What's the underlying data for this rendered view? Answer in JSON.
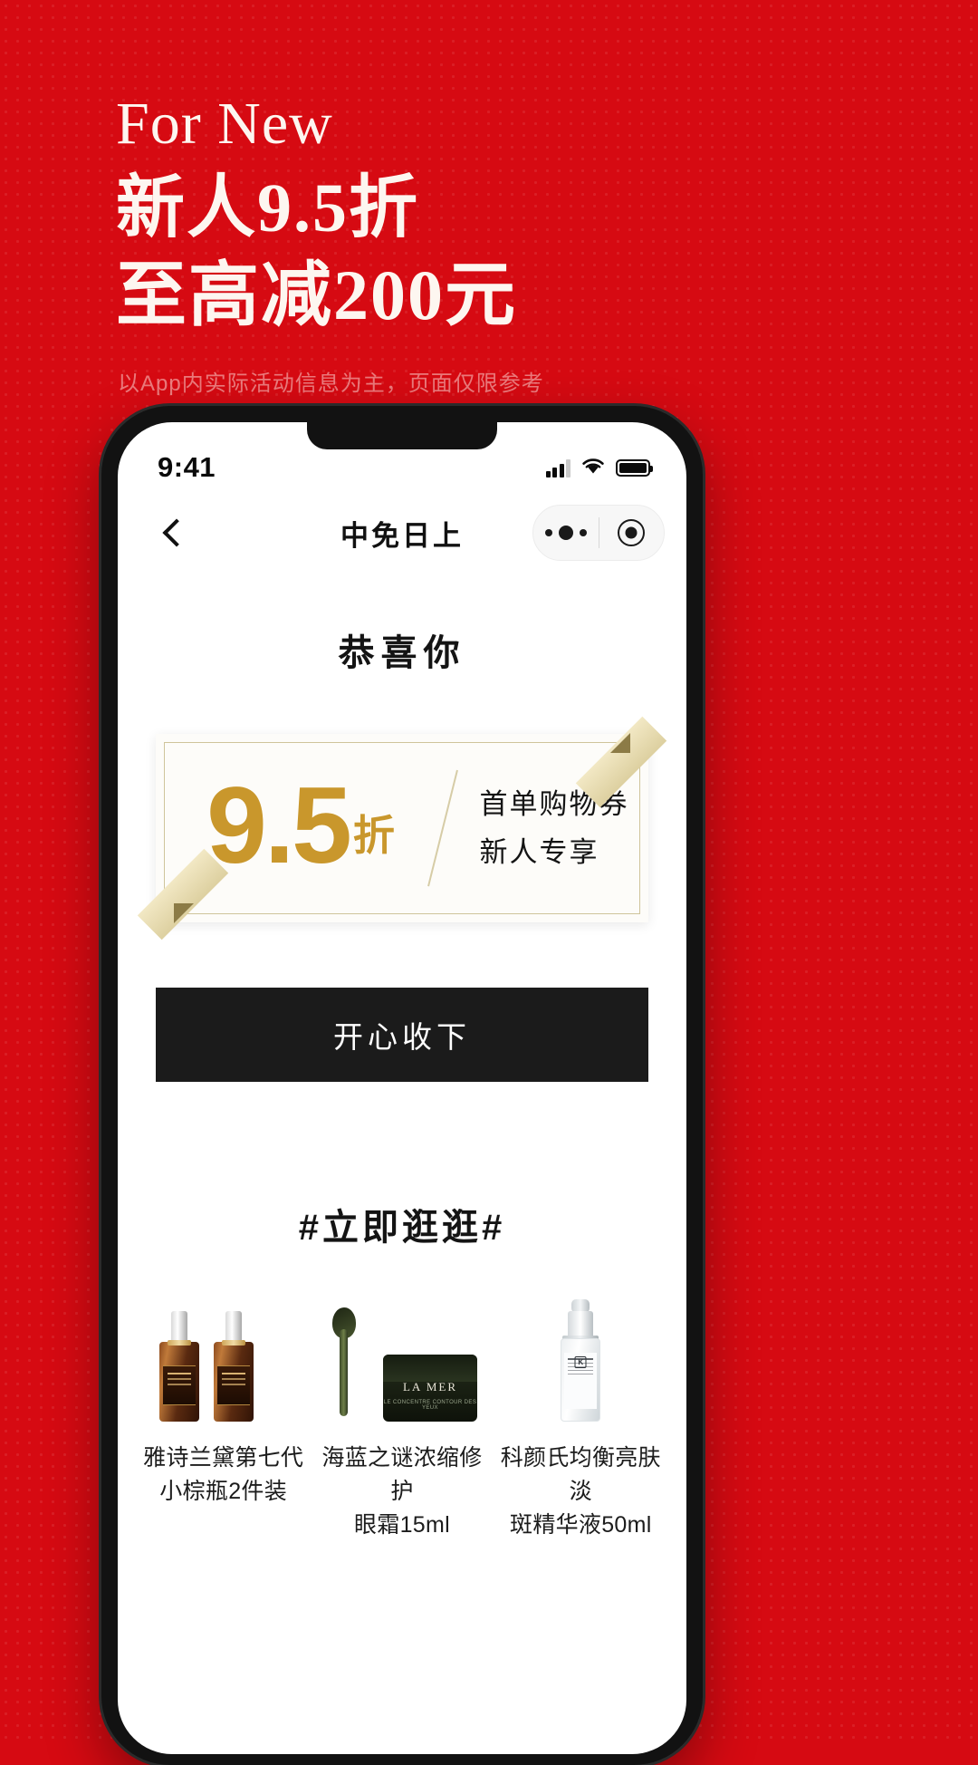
{
  "hero": {
    "english": "For New",
    "line1": "新人9.5折",
    "line2": "至高减200元",
    "note": "以App内实际活动信息为主，页面仅限参考"
  },
  "statusbar": {
    "time": "9:41",
    "signal_icon": "cellular-signal-icon",
    "wifi_icon": "wifi-icon",
    "battery_icon": "battery-icon"
  },
  "navbar": {
    "back_icon": "back-chevron-icon",
    "title": "中免日上",
    "more_icon": "more-dots-icon",
    "target_icon": "target-circle-icon"
  },
  "page": {
    "congrats": "恭喜你",
    "coupon": {
      "amount": "9.5",
      "unit": "折",
      "line1": "首单购物券",
      "line2": "新人专享",
      "accent_color": "#c9972c",
      "border_color": "#cfc49b"
    },
    "cta_label": "开心收下",
    "section_title": "#立即逛逛#",
    "products": [
      {
        "name": "雅诗兰黛第七代\n小棕瓶2件装",
        "image": "estee-lauder-serum-2pack-image"
      },
      {
        "name": "海蓝之谜浓缩修护\n眼霜15ml",
        "image": "la-mer-eye-cream-image"
      },
      {
        "name": "科颜氏均衡亮肤淡\n斑精华液50ml",
        "image": "kiehls-serum-image"
      }
    ]
  },
  "theme": {
    "background_red": "#d60a12",
    "cta_black": "#1b1b1b",
    "gold": "#c9972c"
  }
}
